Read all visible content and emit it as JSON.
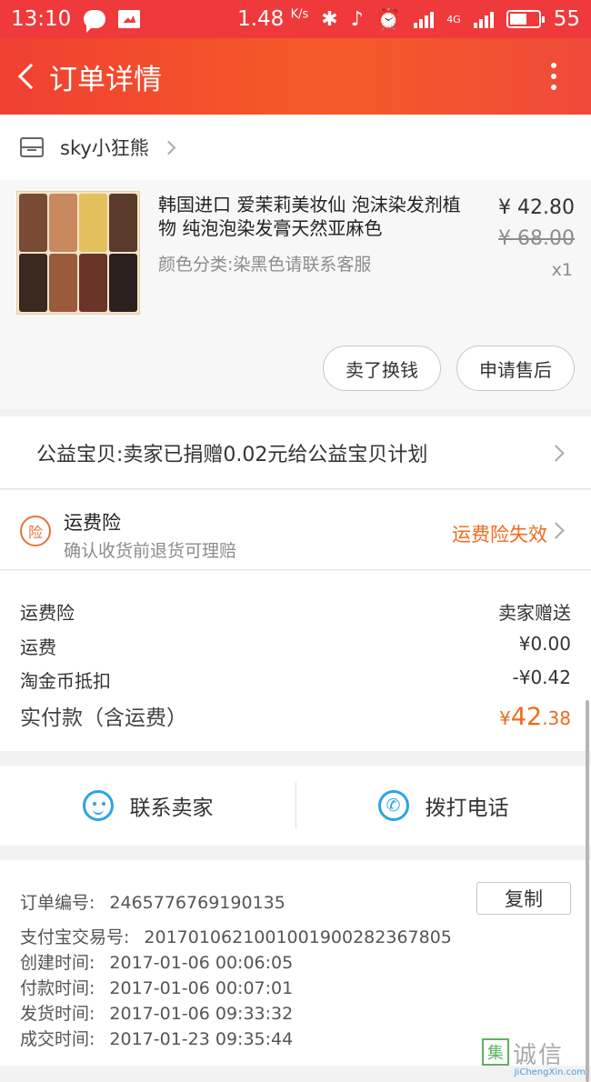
{
  "status_bar": {
    "time": "13:10",
    "speed": "1.48",
    "speed_unit": "K/s",
    "network": "4G",
    "battery": "55"
  },
  "header": {
    "title": "订单详情"
  },
  "shop": {
    "name": "sky小狂熊"
  },
  "product": {
    "title": "韩国进口 爱茉莉美妆仙 泡沫染发剂植物 纯泡泡染发膏天然亚麻色",
    "spec": "颜色分类:染黑色请联系客服",
    "price_now": "¥ 42.80",
    "price_original": "¥ 68.00",
    "quantity": "x1",
    "sell_button": "卖了换钱",
    "after_sale_button": "申请售后"
  },
  "charity": {
    "text": "公益宝贝:卖家已捐赠0.02元给公益宝贝计划"
  },
  "insurance": {
    "badge": "险",
    "title": "运费险",
    "subtitle": "确认收货前退货可理赔",
    "status": "运费险失效"
  },
  "fees": {
    "rows": [
      {
        "label": "运费险",
        "value": "卖家赠送"
      },
      {
        "label": "运费",
        "value": "¥0.00"
      },
      {
        "label": "淘金币抵扣",
        "value": "-¥0.42"
      }
    ],
    "total_label": "实付款（含运费）",
    "total_currency": "¥",
    "total_integer": "42",
    "total_decimal": ".38"
  },
  "contact": {
    "seller_label": "联系卖家",
    "phone_label": "拨打电话",
    "phone_glyph": "✆"
  },
  "order": {
    "number_label": "订单编号:",
    "number": "2465776769190135",
    "copy_button": "复制",
    "rows": [
      {
        "label": "支付宝交易号:",
        "value": "2017010621001001900282367805"
      },
      {
        "label": "创建时间:",
        "value": "2017-01-06 00:06:05"
      },
      {
        "label": "付款时间:",
        "value": "2017-01-06 00:07:01"
      },
      {
        "label": "发货时间:",
        "value": "2017-01-06 09:33:32"
      },
      {
        "label": "成交时间:",
        "value": "2017-01-23 09:35:44"
      }
    ]
  },
  "watermark": {
    "logo": "集",
    "name": "诚信",
    "url": "JiChengXin.com"
  },
  "colors": {
    "brand_red": "#f0393a",
    "accent_orange": "#f06a1d",
    "link_blue": "#2aa4e8"
  }
}
